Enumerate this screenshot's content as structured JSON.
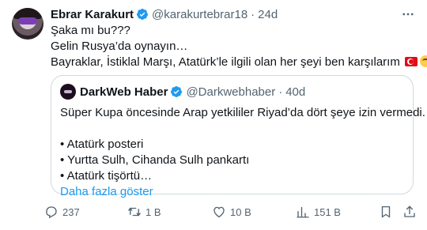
{
  "tweet": {
    "author_name": "Ebrar Karakurt",
    "handle": "@karakurtebrar18",
    "separator": "·",
    "time": "24d",
    "lines": [
      "Şaka mı bu???",
      "Gelin Rusya’da oynayın…",
      "Bayraklar, İstiklal Marşı, Atatürk’le ilgili olan her şeyi ben karşılarım"
    ],
    "icons": [
      "verified-badge-icon",
      "more-icon",
      "turkey-flag-icon",
      "smiling-face-with-tear-icon"
    ]
  },
  "quote": {
    "author_name": "DarkWeb Haber",
    "handle": "@Darkwebhaber",
    "separator": "·",
    "time": "40d",
    "lines": [
      "Süper Kupa öncesinde Arap yetkililer Riyad’da dört şeye izin vermedi.",
      "",
      "• Atatürk posteri",
      "• Yurtta Sulh, Cihanda Sulh pankartı",
      "• Atatürk tişörtü…"
    ],
    "show_more": "Daha fazla göster"
  },
  "actions": {
    "replies": "237",
    "retweets": "1 B",
    "likes": "10 B",
    "views": "151 B",
    "icons": [
      "reply-icon",
      "retweet-icon",
      "like-icon",
      "views-icon",
      "bookmark-icon",
      "share-icon"
    ]
  },
  "colors": {
    "text": "#0f1419",
    "secondary": "#536471",
    "link": "#1d9bf0",
    "verified": "#1d9bf0",
    "border": "#cfd9de"
  }
}
